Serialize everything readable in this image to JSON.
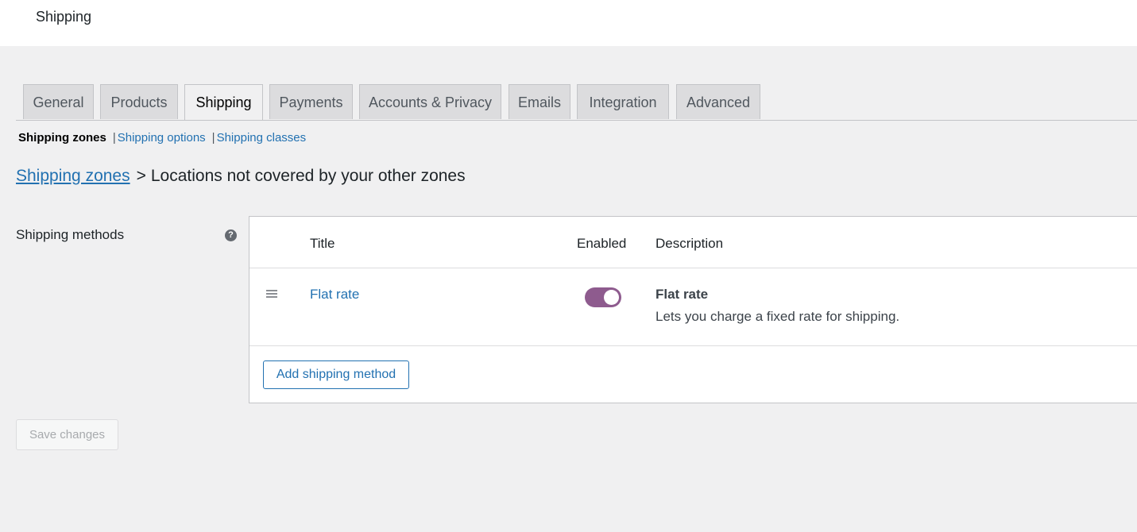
{
  "page": {
    "title": "Shipping"
  },
  "tabs": [
    {
      "label": "General"
    },
    {
      "label": "Products"
    },
    {
      "label": "Shipping"
    },
    {
      "label": "Payments"
    },
    {
      "label": "Accounts & Privacy"
    },
    {
      "label": "Emails"
    },
    {
      "label": "Integration"
    },
    {
      "label": "Advanced"
    }
  ],
  "subnav": {
    "current": "Shipping zones",
    "separator": "|",
    "links": [
      {
        "label": "Shipping options"
      },
      {
        "label": "Shipping classes"
      }
    ]
  },
  "heading": {
    "link": "Shipping zones",
    "separator": ">",
    "text": "Locations not covered by your other zones"
  },
  "methods": {
    "label": "Shipping methods",
    "help_icon": "?",
    "columns": {
      "title": "Title",
      "enabled": "Enabled",
      "description": "Description"
    },
    "rows": [
      {
        "title": "Flat rate",
        "enabled": true,
        "desc_title": "Flat rate",
        "desc_text": "Lets you charge a fixed rate for shipping."
      }
    ],
    "add_button": "Add shipping method"
  },
  "save_button": "Save changes",
  "colors": {
    "link": "#2271b1",
    "toggle_on": "#8e5b8e",
    "background": "#f0f0f1"
  }
}
